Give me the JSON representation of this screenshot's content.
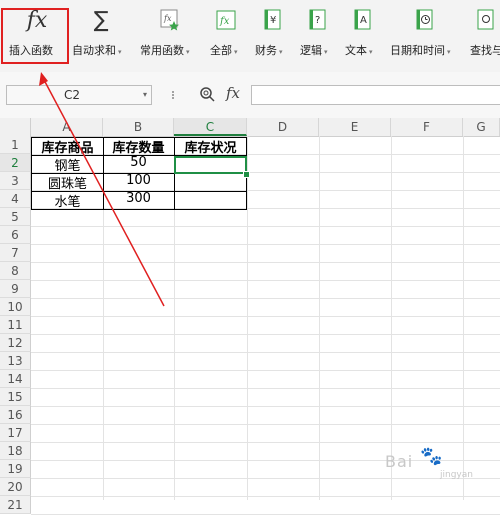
{
  "ribbon": {
    "insert_function": {
      "label": "插入函数",
      "icon": "fx-icon"
    },
    "autosum": {
      "label": "自动求和",
      "icon": "sigma-icon"
    },
    "common": {
      "label": "常用函数",
      "icon": "fx-star-icon"
    },
    "all": {
      "label": "全部",
      "icon": "fx-small-icon"
    },
    "finance": {
      "label": "财务",
      "icon": "yen-book-icon"
    },
    "logic": {
      "label": "逻辑",
      "icon": "question-book-icon"
    },
    "text": {
      "label": "文本",
      "icon": "a-book-icon"
    },
    "datetime": {
      "label": "日期和时间",
      "icon": "clock-book-icon"
    },
    "lookup": {
      "label": "查找与",
      "icon": "lookup-icon"
    },
    "caret": "▾"
  },
  "formula_bar": {
    "name_box": "C2",
    "fx": "fx",
    "formula_value": ""
  },
  "columns": [
    "A",
    "B",
    "C",
    "D",
    "E",
    "F",
    "G"
  ],
  "rows": [
    "1",
    "2",
    "3",
    "4",
    "5",
    "6",
    "7",
    "8",
    "9",
    "10",
    "11",
    "12",
    "13",
    "14",
    "15",
    "16",
    "17",
    "18",
    "19",
    "20",
    "21"
  ],
  "table": {
    "header": [
      "库存商品",
      "库存数量",
      "库存状况"
    ],
    "rows": [
      [
        "钢笔",
        "50",
        ""
      ],
      [
        "圆珠笔",
        "100",
        ""
      ],
      [
        "水笔",
        "300",
        ""
      ]
    ]
  },
  "watermark": {
    "text": "Bai",
    "paw": "🐾",
    "sub": "jingyan"
  },
  "colors": {
    "accent_green": "#1f8f45",
    "annotation_red": "#e02020"
  }
}
